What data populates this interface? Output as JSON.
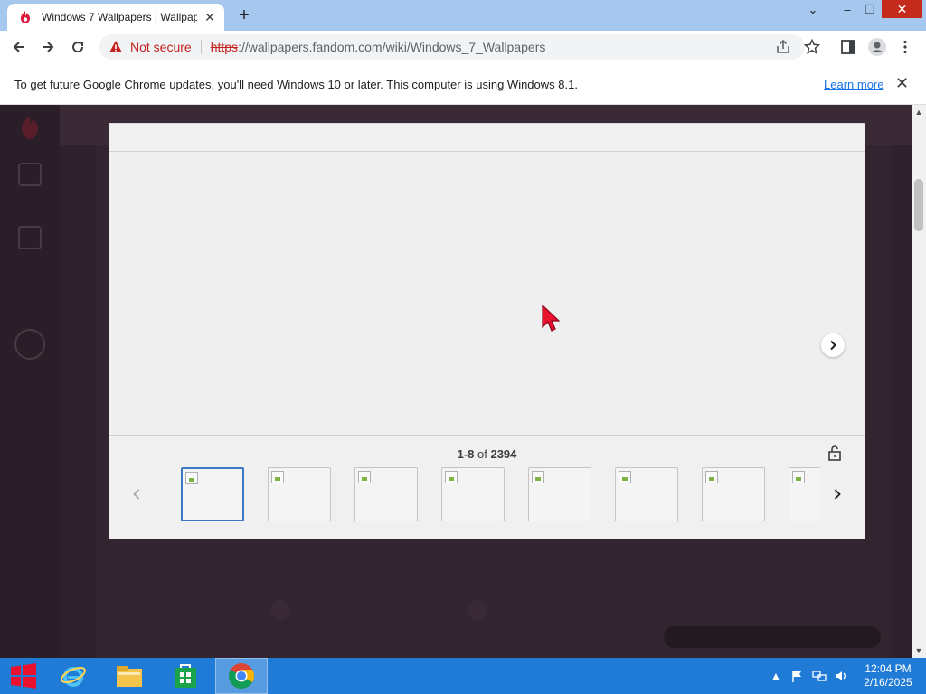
{
  "browser": {
    "tab_title": "Windows 7 Wallpapers | Wallpap",
    "tab_close": "✕",
    "new_tab": "+",
    "tab_search": "⌄",
    "minimize": "–",
    "restore": "❐",
    "close": "✕"
  },
  "toolbar": {
    "security_label": "Not secure",
    "url_scheme": "https",
    "url_sep": "://",
    "url_host": "wallpapers.fandom.com",
    "url_path": "/wiki/Windows_7_Wallpapers"
  },
  "infobar": {
    "message": "To get future Google Chrome updates, you'll need Windows 10 or later. This computer is using Windows 8.1.",
    "learn_more": "Learn more",
    "close": "✕"
  },
  "lightbox": {
    "count_range": "1-8",
    "count_of": " of ",
    "count_total": "2394",
    "thumbnails": 8
  },
  "taskbar": {
    "time": "12:04 PM",
    "date": "2/16/2025"
  },
  "colors": {
    "accent": "#1a73e8",
    "warning": "#c5221f",
    "taskbar": "#1f7bd6",
    "thumb_active": "#3b78c7"
  }
}
